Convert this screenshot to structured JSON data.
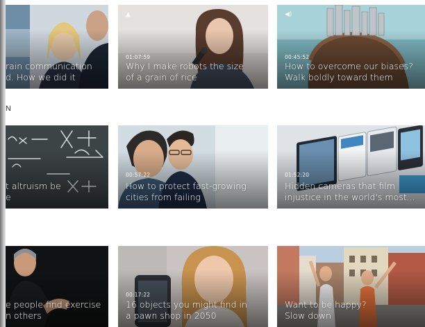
{
  "section": {
    "label": "N"
  },
  "cards": [
    {
      "title_lines": [
        "rain communication",
        "d. How we did it"
      ],
      "duration": ""
    },
    {
      "title_lines": [
        "Why I make robots the size",
        "of a grain of rice"
      ],
      "duration": "01:07:59",
      "icon": "image-icon"
    },
    {
      "title_lines": [
        "How to overcome our biases?",
        "Walk boldly toward them"
      ],
      "duration": "00:45:52",
      "icon": "speaker-icon"
    },
    {
      "title_lines": [
        "t altruism be",
        "e"
      ],
      "duration": ""
    },
    {
      "title_lines": [
        "How to protect fast-growing",
        "cities from failing"
      ],
      "duration": "00:57:22"
    },
    {
      "title_lines": [
        "Hidden cameras that film",
        "injustice in the world's most..."
      ],
      "duration": "01:52:20"
    },
    {
      "title_lines": [
        "e people find exercise",
        "n others"
      ],
      "duration": ""
    },
    {
      "title_lines": [
        "16 objects you might find in",
        "a pawn shop in 2050"
      ],
      "duration": "00:17:22"
    },
    {
      "title_lines": [
        "Want to be happy?",
        "Slow down"
      ],
      "duration": ""
    }
  ],
  "colors": {
    "page_bg": "#ffffff",
    "text": "#ffffff"
  }
}
